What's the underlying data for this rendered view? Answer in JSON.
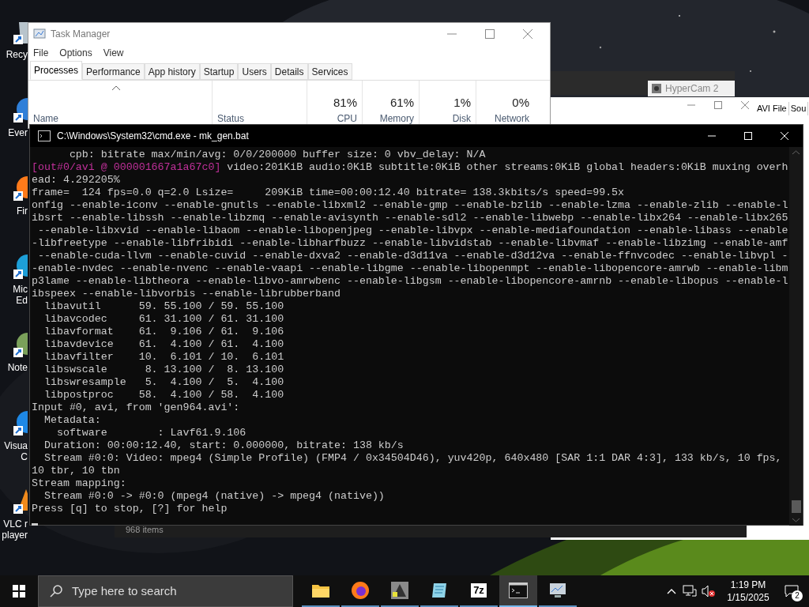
{
  "desktop_icons": [
    {
      "kind": "recycle",
      "lines": [
        "Recy"
      ]
    },
    {
      "kind": "shortcut-blue",
      "lines": [
        "Ever"
      ]
    },
    {
      "kind": "firefox",
      "lines": [
        "Fir"
      ]
    },
    {
      "kind": "edge",
      "lines": [
        "Mic",
        "Ed"
      ]
    },
    {
      "kind": "notepad",
      "lines": [
        "Note"
      ]
    },
    {
      "kind": "vscode",
      "lines": [
        "Visua",
        "C"
      ]
    },
    {
      "kind": "vlc",
      "lines": [
        "VLC r",
        "player"
      ]
    }
  ],
  "task_manager": {
    "title": "Task Manager",
    "menu": [
      "File",
      "Options",
      "View"
    ],
    "tabs": [
      {
        "label": "Processes",
        "selected": true
      },
      {
        "label": "Performance",
        "selected": false
      },
      {
        "label": "App history",
        "selected": false
      },
      {
        "label": "Startup",
        "selected": false
      },
      {
        "label": "Users",
        "selected": false
      },
      {
        "label": "Details",
        "selected": false
      },
      {
        "label": "Services",
        "selected": false
      }
    ],
    "columns": [
      {
        "label": "Name"
      },
      {
        "label": "Status"
      },
      {
        "label": "CPU",
        "value": "81%"
      },
      {
        "label": "Memory",
        "value": "61%"
      },
      {
        "label": "Disk",
        "value": "1%"
      },
      {
        "label": "Network",
        "value": "0%"
      }
    ]
  },
  "hypercam": {
    "title": "HyperCam 2",
    "menu": [
      "AVI File",
      "Sou"
    ]
  },
  "explorer": {
    "status": "968 items"
  },
  "console": {
    "title": "C:\\Windows\\System32\\cmd.exe - mk_gen.bat",
    "lines": [
      {
        "text": "      cpb: bitrate max/min/avg: 0/0/200000 buffer size: 0 vbv_delay: N/A"
      },
      {
        "kind": "tagged",
        "tag": "[out#0/avi @ 000001667a1a67c0]",
        "text": " video:201KiB audio:0KiB subtitle:0KiB other streams:0KiB global headers:0KiB muxing overh"
      },
      {
        "text": "ead: 4.292205%"
      },
      {
        "text": "frame=  124 fps=0.0 q=2.0 Lsize=     209KiB time=00:00:12.40 bitrate= 138.3kbits/s speed=99.5x"
      },
      {
        "text": "onfig --enable-iconv --enable-gnutls --enable-libxml2 --enable-gmp --enable-bzlib --enable-lzma --enable-zlib --enable-l"
      },
      {
        "text": "ibsrt --enable-libssh --enable-libzmq --enable-avisynth --enable-sdl2 --enable-libwebp --enable-libx264 --enable-libx265"
      },
      {
        "text": " --enable-libxvid --enable-libaom --enable-libopenjpeg --enable-libvpx --enable-mediafoundation --enable-libass --enable"
      },
      {
        "text": "-libfreetype --enable-libfribidi --enable-libharfbuzz --enable-libvidstab --enable-libvmaf --enable-libzimg --enable-amf"
      },
      {
        "text": " --enable-cuda-llvm --enable-cuvid --enable-dxva2 --enable-d3d11va --enable-d3d12va --enable-ffnvcodec --enable-libvpl -"
      },
      {
        "text": "-enable-nvdec --enable-nvenc --enable-vaapi --enable-libgme --enable-libopenmpt --enable-libopencore-amrwb --enable-libm"
      },
      {
        "text": "p3lame --enable-libtheora --enable-libvo-amrwbenc --enable-libgsm --enable-libopencore-amrnb --enable-libopus --enable-l"
      },
      {
        "text": "ibspeex --enable-libvorbis --enable-librubberband"
      },
      {
        "text": "  libavutil      59. 55.100 / 59. 55.100"
      },
      {
        "text": "  libavcodec     61. 31.100 / 61. 31.100"
      },
      {
        "text": "  libavformat    61.  9.106 / 61.  9.106"
      },
      {
        "text": "  libavdevice    61.  4.100 / 61.  4.100"
      },
      {
        "text": "  libavfilter    10.  6.101 / 10.  6.101"
      },
      {
        "text": "  libswscale      8. 13.100 /  8. 13.100"
      },
      {
        "text": "  libswresample   5.  4.100 /  5.  4.100"
      },
      {
        "text": "  libpostproc    58.  4.100 / 58.  4.100"
      },
      {
        "text": "Input #0, avi, from 'gen964.avi':"
      },
      {
        "text": "  Metadata:"
      },
      {
        "text": "    software        : Lavf61.9.106"
      },
      {
        "text": "  Duration: 00:00:12.40, start: 0.000000, bitrate: 138 kb/s"
      },
      {
        "text": "  Stream #0:0: Video: mpeg4 (Simple Profile) (FMP4 / 0x34504D46), yuv420p, 640x480 [SAR 1:1 DAR 4:3], 133 kb/s, 10 fps,"
      },
      {
        "text": "10 tbr, 10 tbn"
      },
      {
        "text": "Stream mapping:"
      },
      {
        "text": "  Stream #0:0 -> #0:0 (mpeg4 (native) -> mpeg4 (native))"
      },
      {
        "text": "Press [q] to stop, [?] for help"
      }
    ]
  },
  "taskbar": {
    "search_placeholder": "Type here to search",
    "apps": [
      {
        "kind": "folder",
        "selected": false
      },
      {
        "kind": "firefox",
        "selected": false
      },
      {
        "kind": "media",
        "selected": false
      },
      {
        "kind": "notepad",
        "selected": false
      },
      {
        "kind": "archive",
        "label": "7z",
        "selected": false
      },
      {
        "kind": "terminal",
        "selected": true
      },
      {
        "kind": "monitor",
        "selected": false
      }
    ],
    "time": "1:19 PM",
    "date": "1/15/2025",
    "notifications": "2"
  }
}
